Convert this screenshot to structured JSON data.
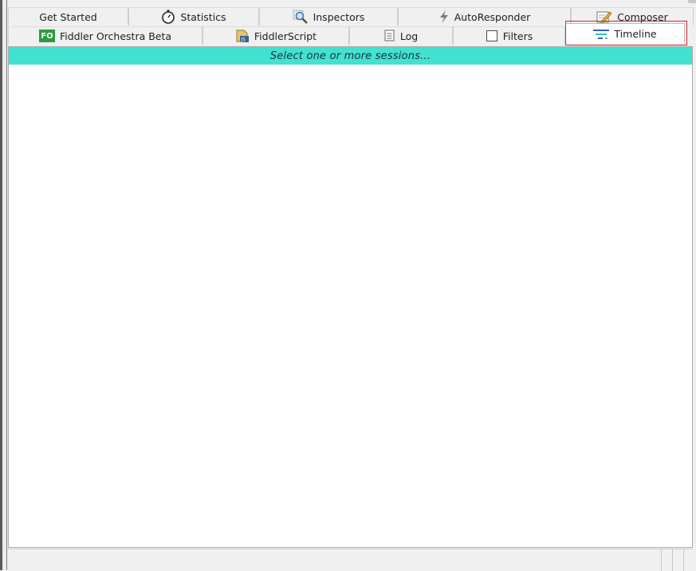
{
  "tabs_row1": [
    {
      "id": "get-started",
      "label": "Get Started",
      "icon": null
    },
    {
      "id": "statistics",
      "label": "Statistics",
      "icon": "stopwatch-icon"
    },
    {
      "id": "inspectors",
      "label": "Inspectors",
      "icon": "magnifier-icon"
    },
    {
      "id": "autoresponder",
      "label": "AutoResponder",
      "icon": "lightning-icon"
    },
    {
      "id": "composer",
      "label": "Composer",
      "icon": "pencil-note-icon"
    }
  ],
  "tabs_row2": [
    {
      "id": "fiddler-orchestra",
      "label": "Fiddler Orchestra Beta",
      "icon": "fo-badge-icon",
      "icon_text": "FO"
    },
    {
      "id": "fiddlerscript",
      "label": "FiddlerScript",
      "icon": "script-js-icon"
    },
    {
      "id": "log",
      "label": "Log",
      "icon": "log-icon"
    },
    {
      "id": "filters",
      "label": "Filters",
      "icon": "checkbox-icon"
    },
    {
      "id": "timeline",
      "label": "Timeline",
      "icon": "timeline-icon",
      "selected": true
    }
  ],
  "timeline": {
    "banner_text": "Select one or more sessions..."
  },
  "colors": {
    "banner_bg": "#41e2cf",
    "highlight": "#d62828",
    "fo_badge": "#2d9b3f"
  }
}
